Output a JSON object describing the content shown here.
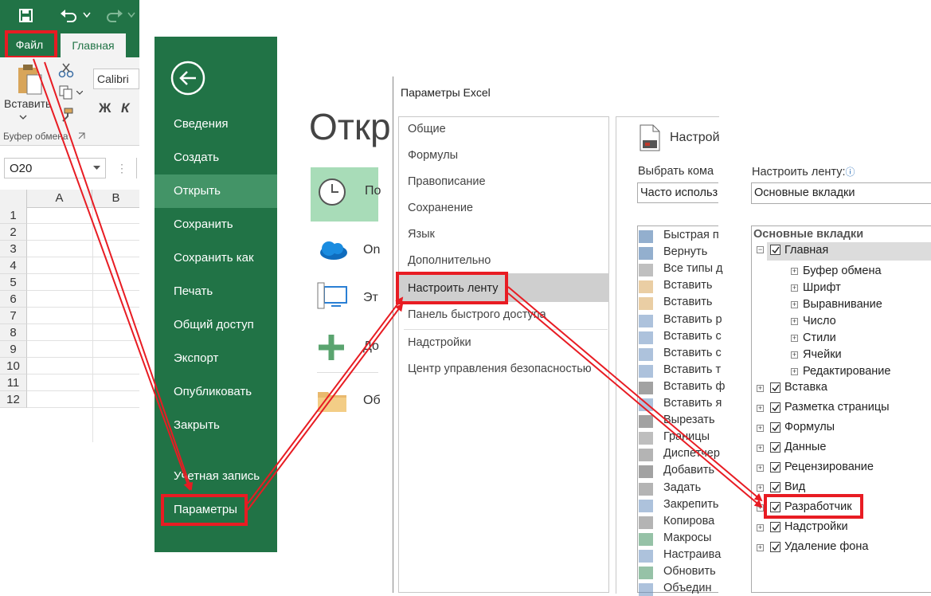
{
  "excel": {
    "tab_file": "Файл",
    "tab_home": "Главная",
    "paste_label": "Вставить",
    "font_name": "Calibri",
    "bold": "Ж",
    "italic": "К",
    "clipboard_group": "Буфер обмена",
    "name_box": "O20",
    "col_a": "A",
    "col_b": "B",
    "rows": [
      "1",
      "2",
      "3",
      "4",
      "5",
      "6",
      "7",
      "8",
      "9",
      "10",
      "11",
      "12"
    ]
  },
  "backstage": {
    "open_title": "Откр",
    "items": [
      "Сведения",
      "Создать",
      "Открыть",
      "Сохранить",
      "Сохранить как",
      "Печать",
      "Общий доступ",
      "Экспорт",
      "Опубликовать",
      "Закрыть"
    ],
    "account": "Учетная запись",
    "options": "Параметры",
    "locations": [
      "По",
      "On",
      "Эт",
      "До",
      "Об"
    ]
  },
  "options_dialog": {
    "title": "Параметры Excel",
    "nav": [
      "Общие",
      "Формулы",
      "Правописание",
      "Сохранение",
      "Язык",
      "Дополнительно",
      "Настроить ленту",
      "Панель быстрого доступа",
      "Надстройки",
      "Центр управления безопасностью"
    ],
    "heading": "Настрой",
    "choose_label": "Выбрать кома",
    "choose_value": "Часто использ",
    "commands": [
      "Быстрая п",
      "Вернуть",
      "Все типы д",
      "Вставить",
      "Вставить",
      "Вставить р",
      "Вставить с",
      "Вставить с",
      "Вставить т",
      "Вставить ф",
      "Вставить я",
      "Вырезать",
      "Границы",
      "Диспетчер",
      "Добавить",
      "Задать",
      "Закрепить",
      "Копирова",
      "Макросы",
      "Настраива",
      "Обновить",
      "Объедин"
    ]
  },
  "ribbon_custom": {
    "label": "Настроить ленту:",
    "dropdown_value": "Основные вкладки",
    "tree_header": "Основные вкладки",
    "home": "Главная",
    "home_groups": [
      "Буфер обмена",
      "Шрифт",
      "Выравнивание",
      "Число",
      "Стили",
      "Ячейки",
      "Редактирование"
    ],
    "tabs": [
      "Вставка",
      "Разметка страницы",
      "Формулы",
      "Данные",
      "Рецензирование",
      "Вид",
      "Разработчик",
      "Надстройки",
      "Удаление фона"
    ]
  },
  "colors": {
    "excel_green": "#217346",
    "highlight": "#e81c23",
    "backstage_active": "#439467"
  }
}
